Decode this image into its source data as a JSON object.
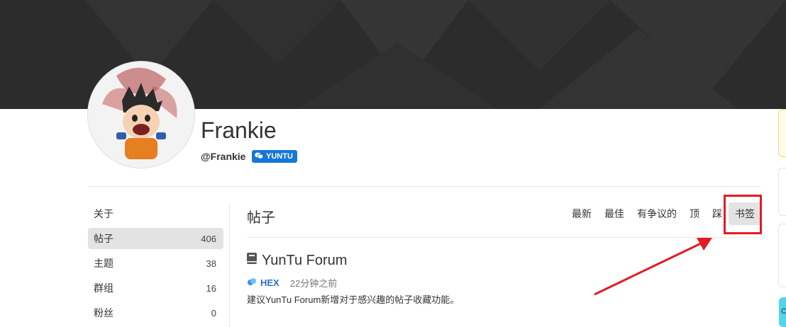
{
  "profile": {
    "name": "Frankie",
    "handle": "@Frankie",
    "badge": "YUNTU"
  },
  "sidebar": {
    "items": [
      {
        "label": "关于",
        "count": ""
      },
      {
        "label": "帖子",
        "count": "406"
      },
      {
        "label": "主题",
        "count": "38"
      },
      {
        "label": "群组",
        "count": "16"
      },
      {
        "label": "粉丝",
        "count": "0"
      }
    ]
  },
  "main": {
    "title": "帖子",
    "filters": [
      "最新",
      "最佳",
      "有争议的",
      "顶",
      "踩",
      "书签"
    ],
    "active_filter": "书签"
  },
  "post": {
    "title": "YunTu Forum",
    "author": "HEX",
    "time": "22分钟之前",
    "body": "建议YunTu Forum新增对于感兴趣的帖子收藏功能。"
  },
  "right_edge_char": "C",
  "colors": {
    "banner": "#2c2c2c",
    "badge": "#1677d8",
    "highlight": "#e21c22",
    "author": "#2d6fc5"
  }
}
